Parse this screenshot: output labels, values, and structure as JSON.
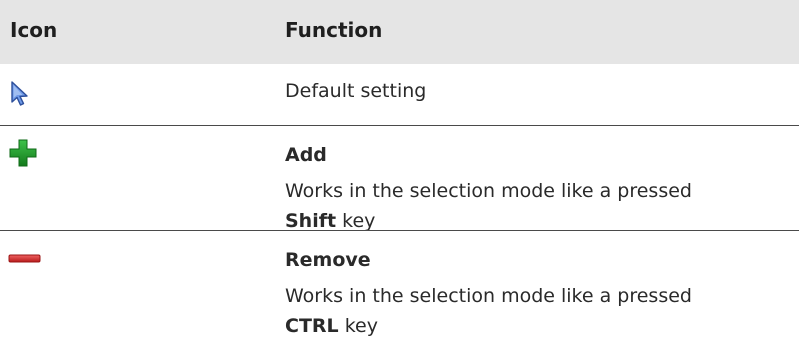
{
  "table": {
    "headers": {
      "icon": "Icon",
      "function": "Function"
    },
    "rows": [
      {
        "icon": "pointer-arrow-icon",
        "text": "Default setting"
      },
      {
        "icon": "plus-icon",
        "title": "Add",
        "desc": "Works in the selection mode like a pressed",
        "key": "Shift",
        "suffix": "key"
      },
      {
        "icon": "minus-icon",
        "title": "Remove",
        "desc": "Works in the selection mode like a pressed",
        "key": "CTRL",
        "suffix": "key"
      }
    ]
  },
  "colors": {
    "header_bg": "#e5e5e5",
    "plus": "#1f9a2a",
    "minus": "#d42a2a",
    "pointer": "#4a7fd6"
  }
}
